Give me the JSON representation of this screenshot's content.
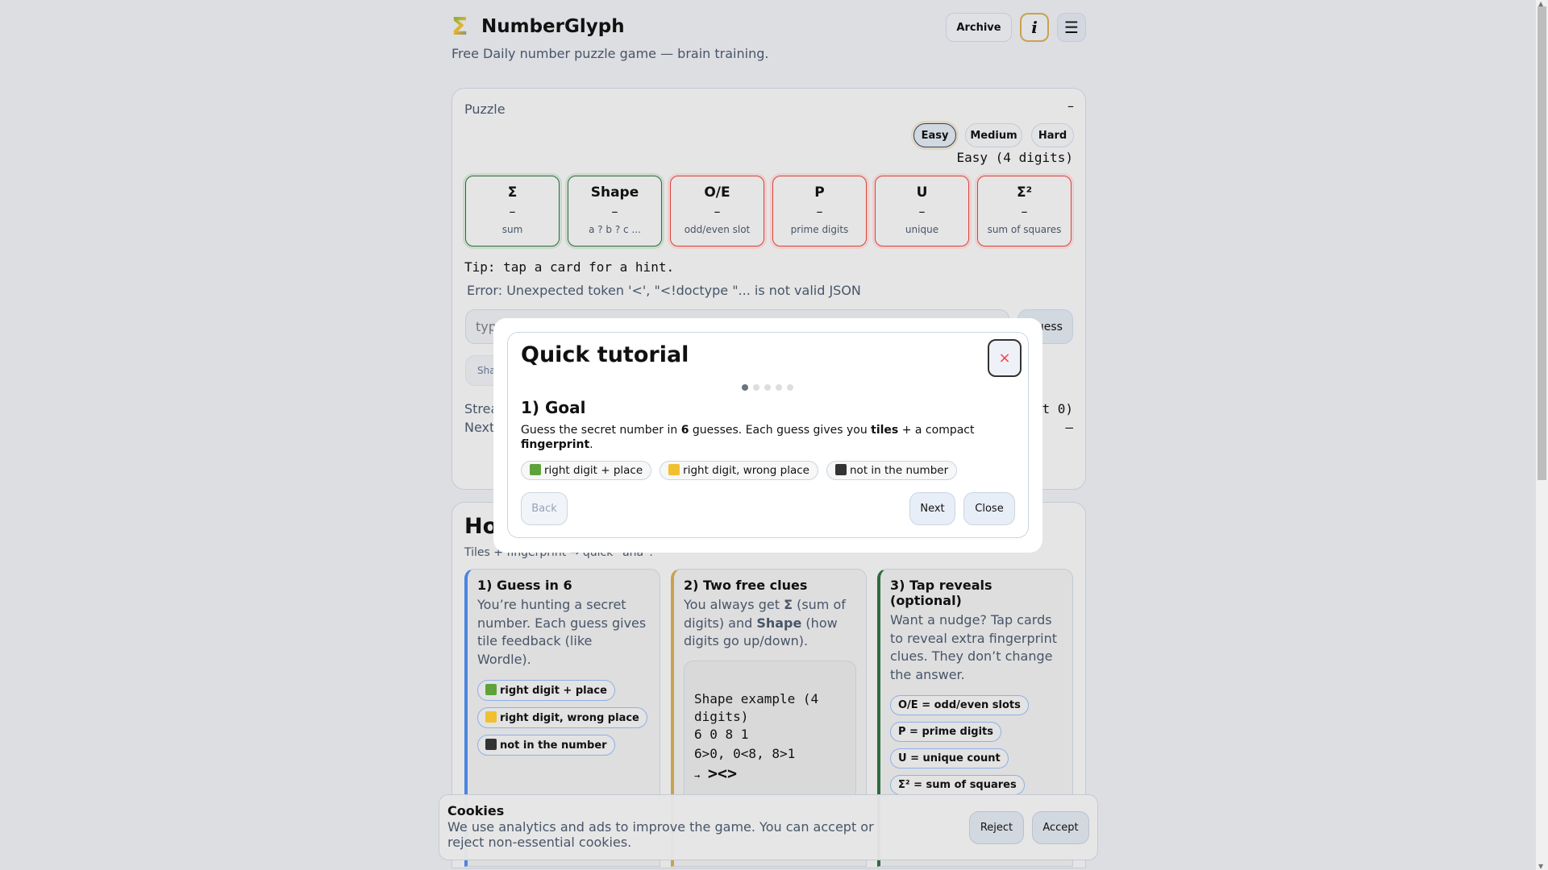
{
  "header": {
    "title": "NumberGlyph",
    "logo": "Σ",
    "subtitle": "Free Daily number puzzle game — brain training.",
    "archive": "Archive",
    "info": "i",
    "menu": "☰"
  },
  "puzzle": {
    "label": "Puzzle",
    "collapse": "–",
    "difficulties": [
      "Easy",
      "Medium",
      "Hard"
    ],
    "selected": "Easy",
    "difficulty_text": "Easy (4 digits)",
    "clues": [
      {
        "key": "Σ",
        "value": "–",
        "desc": "sum",
        "status": "revealed"
      },
      {
        "key": "Shape",
        "value": "–",
        "desc": "a ? b ? c ...",
        "status": "revealed"
      },
      {
        "key": "O/E",
        "value": "–",
        "desc": "odd/even slot",
        "status": "locked"
      },
      {
        "key": "P",
        "value": "–",
        "desc": "prime digits",
        "status": "locked"
      },
      {
        "key": "U",
        "value": "–",
        "desc": "unique",
        "status": "locked"
      },
      {
        "key": "Σ²",
        "value": "–",
        "desc": "sum of squares",
        "status": "locked"
      }
    ],
    "tip": "Tip: tap a card for a hint.",
    "error": "Error: Unexpected token '<', \"<!doctype \"... is not valid JSON",
    "input_placeholder": "type",
    "guess": "Guess",
    "share": "Share",
    "streak_label": "Streak",
    "streak_value": "t 0)",
    "next_label": "Next",
    "next_value": "–"
  },
  "how": {
    "title": "How to play",
    "subtitle": "Tiles + fingerprint → quick “aha”.",
    "cols": [
      {
        "title": "1) Guess in 6",
        "text": "You’re hunting a secret number. Each guess gives tile feedback (like Wordle).",
        "chips": [
          "right digit + place",
          "right digit, wrong place",
          "not in the number"
        ]
      },
      {
        "title": "2) Two free clues",
        "text_pre": "You always get ",
        "b1": "Σ",
        "text_mid": " (sum of digits) and ",
        "b2": "Shape",
        "text_post": " (how digits go up/down).",
        "example_title": "Shape example (4 digits)",
        "example_digits": "6 0 8 1",
        "example_cmp": "6>0, 0<8, 8>1",
        "example_arrow": "→",
        "example_shape": "><>"
      },
      {
        "title": "3) Tap reveals (optional)",
        "text": "Want a nudge? Tap cards to reveal extra fingerprint clues. They don’t change the answer.",
        "chips": [
          "O/E = odd/even slots",
          "P = prime digits",
          "U = unique count",
          "Σ² = sum of squares"
        ]
      }
    ]
  },
  "modal": {
    "title": "Quick tutorial",
    "close_icon": "×",
    "step": 1,
    "steps": 5,
    "heading": "1) Goal",
    "p1": "Guess the secret number in ",
    "b1": "6",
    "p2": " guesses. Each guess gives you ",
    "b2": "tiles",
    "p3": " + a compact ",
    "b3": "fingerprint",
    "p4": ".",
    "chips": [
      "right digit + place",
      "right digit, wrong place",
      "not in the number"
    ],
    "back": "Back",
    "next": "Next",
    "close": "Close"
  },
  "cookies": {
    "title": "Cookies",
    "text": "We use analytics and ads to improve the game. You can accept or reject non-essential cookies.",
    "reject": "Reject",
    "accept": "Accept"
  },
  "colors": {
    "green": "#5ea33a",
    "yellow": "#f0c030",
    "black": "#333333",
    "accent_blue": "#4a84e0",
    "accent_gold": "#c9a24e",
    "accent_green": "#2e6b3e"
  }
}
